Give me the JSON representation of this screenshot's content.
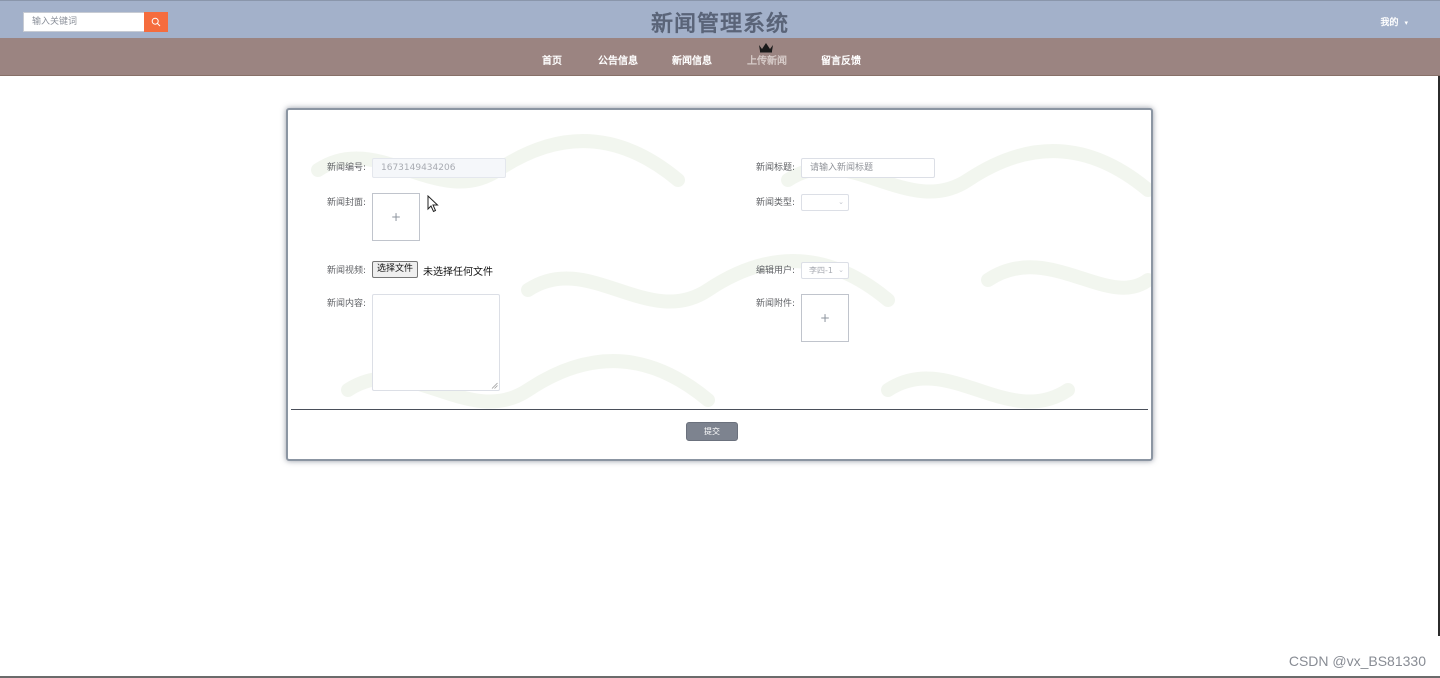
{
  "header": {
    "search_placeholder": "输入关键词",
    "title": "新闻管理系统",
    "user_menu": "我的"
  },
  "nav": {
    "items": [
      {
        "label": "首页"
      },
      {
        "label": "公告信息"
      },
      {
        "label": "新闻信息"
      },
      {
        "label": "上传新闻",
        "active": true
      },
      {
        "label": "留言反馈"
      }
    ]
  },
  "form": {
    "news_no_label": "新闻编号:",
    "news_no_value": "1673149434206",
    "title_label": "新闻标题:",
    "title_placeholder": "请输入新闻标题",
    "cover_label": "新闻封面:",
    "type_label": "新闻类型:",
    "video_label": "新闻视频:",
    "file_button": "选择文件",
    "file_status": "未选择任何文件",
    "editor_label": "编辑用户:",
    "editor_value": "李四-1",
    "content_label": "新闻内容:",
    "attachment_label": "新闻附件:",
    "upload_plus": "+",
    "submit_label": "提交"
  },
  "watermark": "CSDN @vx_BS81330",
  "colors": {
    "topbar": "#a3b1ca",
    "nav": "#9b8481",
    "search_button": "#f56c3d",
    "submit": "#7d838f"
  },
  "icons": {
    "search": "search-icon",
    "crown": "crown-icon",
    "caret": "caret-down-icon"
  }
}
